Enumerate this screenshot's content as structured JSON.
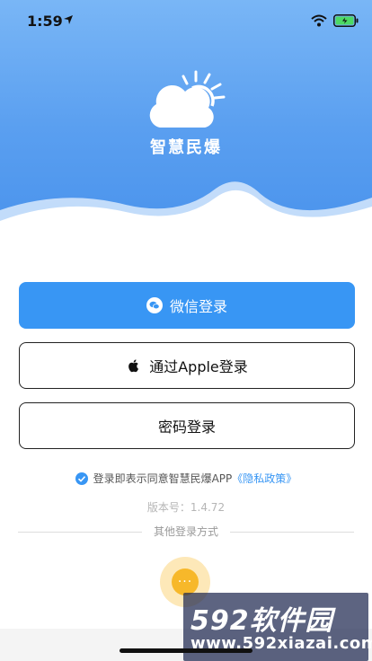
{
  "status_bar": {
    "time": "1:59"
  },
  "app": {
    "name": "智慧民爆"
  },
  "buttons": {
    "wechat_label": "微信登录",
    "apple_label": "通过Apple登录",
    "password_label": "密码登录"
  },
  "agreement": {
    "text": "登录即表示同意智慧民爆APP",
    "policy_link": "《隐私政策》"
  },
  "version": "版本号：1.4.72",
  "other_methods": {
    "label": "其他登录方式",
    "more_glyph": "···"
  },
  "watermark": {
    "brand": "592软件园",
    "url": "www.592xiazai.com"
  },
  "colors": {
    "primary": "#3896f4",
    "hero_top": "#79b6f6",
    "hero_bottom": "#4a93ec",
    "more_accent": "#f7b82a",
    "battery": "#4cd964"
  }
}
